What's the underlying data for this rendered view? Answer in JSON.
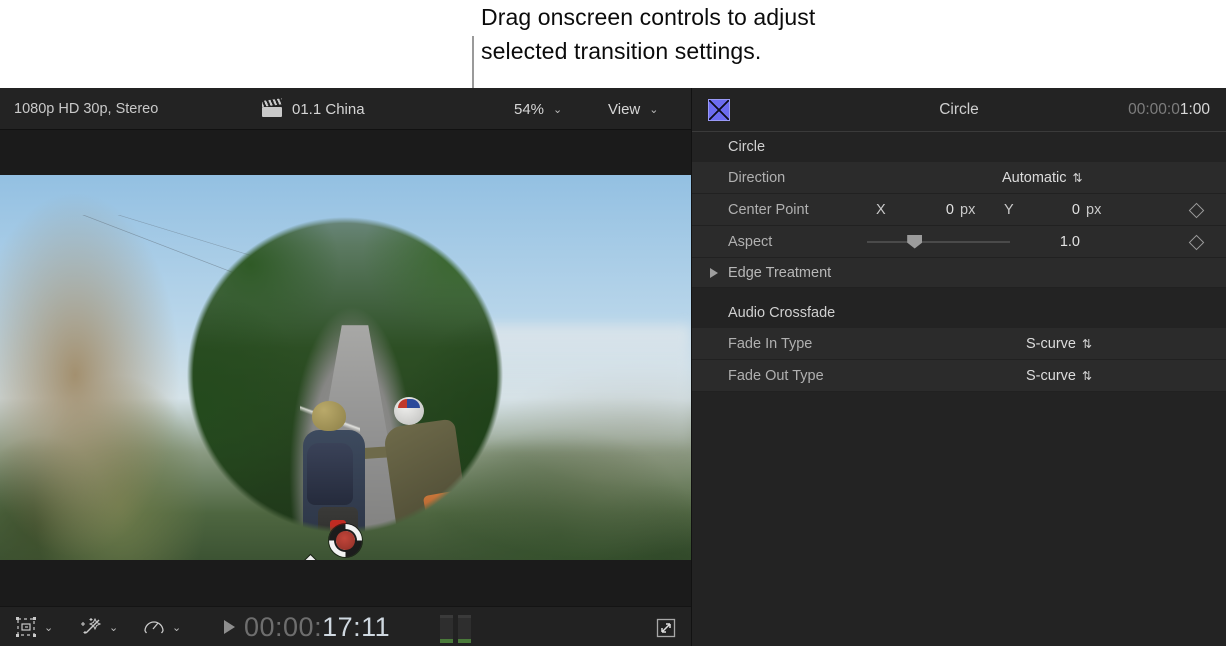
{
  "callout": {
    "line1": "Drag onscreen controls to adjust",
    "line2": "selected transition settings."
  },
  "viewer": {
    "topbar": {
      "format": "1080p HD 30p, Stereo",
      "project_icon": "clapperboard-icon",
      "project_name": "01.1 China",
      "zoom_level": "54%",
      "zoom_chevron": "⌄",
      "view_label": "View",
      "view_chevron": "⌄"
    },
    "onscreen_controls": {
      "center_target": "circle-target-handle",
      "aspect_handle": "diamond-aspect-handle"
    },
    "bottombar": {
      "transform_icon": "transform-tools-icon",
      "transform_chevron": "⌄",
      "enhance_icon": "enhancements-wand-icon",
      "enhance_chevron": "⌄",
      "retime_icon": "retime-speedometer-icon",
      "retime_chevron": "⌄",
      "play_icon": "play-triangle-icon",
      "timecode_dim": "00:00:",
      "timecode_bright": "17:11",
      "audio_meters": "audio-level-meters",
      "expand_icon": "expand-viewer-icon"
    }
  },
  "inspector": {
    "header": {
      "icon": "transition-bowtie-icon",
      "title": "Circle",
      "duration_dim": "00:00:0",
      "duration_bright": "1:00"
    },
    "sections": [
      {
        "title": "Circle",
        "rows": [
          {
            "label": "Direction",
            "type": "popup",
            "value": "Automatic",
            "chevron": "⇅"
          },
          {
            "label": "Center Point",
            "type": "point",
            "x_label": "X",
            "x_value": "0",
            "x_unit": "px",
            "y_label": "Y",
            "y_value": "0",
            "y_unit": "px",
            "keyframe": "keyframe-diamond-icon"
          },
          {
            "label": "Aspect",
            "type": "slider",
            "value": "1.0",
            "slider_percent": 33,
            "keyframe": "keyframe-diamond-icon"
          },
          {
            "label": "Edge Treatment",
            "type": "disclosure",
            "triangle": "disclosure-triangle-icon"
          }
        ]
      },
      {
        "title": "Audio Crossfade",
        "rows": [
          {
            "label": "Fade In Type",
            "type": "popup",
            "value": "S-curve",
            "chevron": "⇅"
          },
          {
            "label": "Fade Out Type",
            "type": "popup",
            "value": "S-curve",
            "chevron": "⇅"
          }
        ]
      }
    ]
  },
  "colors": {
    "accent_transition": "#6b6bf0",
    "panel_bg": "#232323",
    "row_bg": "#2b2b2b",
    "text_primary": "#d8d8d8",
    "text_secondary": "#b0b0b0",
    "meter_green": "#4a7a3a"
  }
}
